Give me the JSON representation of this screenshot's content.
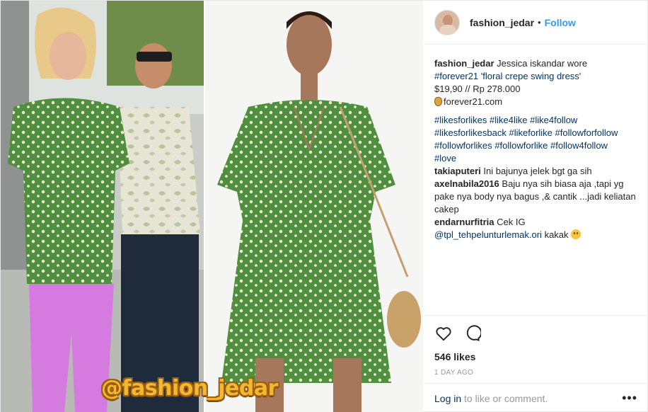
{
  "post": {
    "username": "fashion_jedar",
    "separator": "•",
    "follow_label": "Follow",
    "watermark": "@fashion_jedar"
  },
  "caption": {
    "username": "fashion_jedar",
    "line1": "Jessica iskandar wore",
    "line2": "#forever21 'floral crepe swing dress'",
    "line3": "$19,90 // Rp 278.000",
    "line4": "forever21.com",
    "hashtags1": "#likesforlikes #like4like #like4follow",
    "hashtags2": "#likesforlikesback #likeforlike #followforfollow",
    "hashtags3": "#followforlikes #followforlike #follow4follow",
    "hashtags4": "#love"
  },
  "comments": [
    {
      "user": "takiaputeri",
      "text": "Ini bajunya jelek bgt ga sih"
    },
    {
      "user": "axelnabila2016",
      "text": "Baju nya sih biasa aja ,tapi yg pake nya body nya bagus ,& cantik ...jadi keliatan cakep"
    },
    {
      "user": "endarnurfitria",
      "text": "Cek IG",
      "mention": "@tpl_tehpelunturlemak.ori",
      "tail": "kakak"
    }
  ],
  "stats": {
    "likes": "546 likes",
    "time": "1 DAY AGO"
  },
  "footer": {
    "login": "Log in",
    "rest": "to like or comment.",
    "more": "•••"
  },
  "colors": {
    "accent": "#3897f0",
    "link": "#003569",
    "dress_green": "#4f8f3d",
    "pants_pink": "#d57be0"
  },
  "icons": [
    "heart-icon",
    "comment-icon",
    "more-options-icon",
    "money-bag-icon",
    "smile-emoji-icon"
  ]
}
